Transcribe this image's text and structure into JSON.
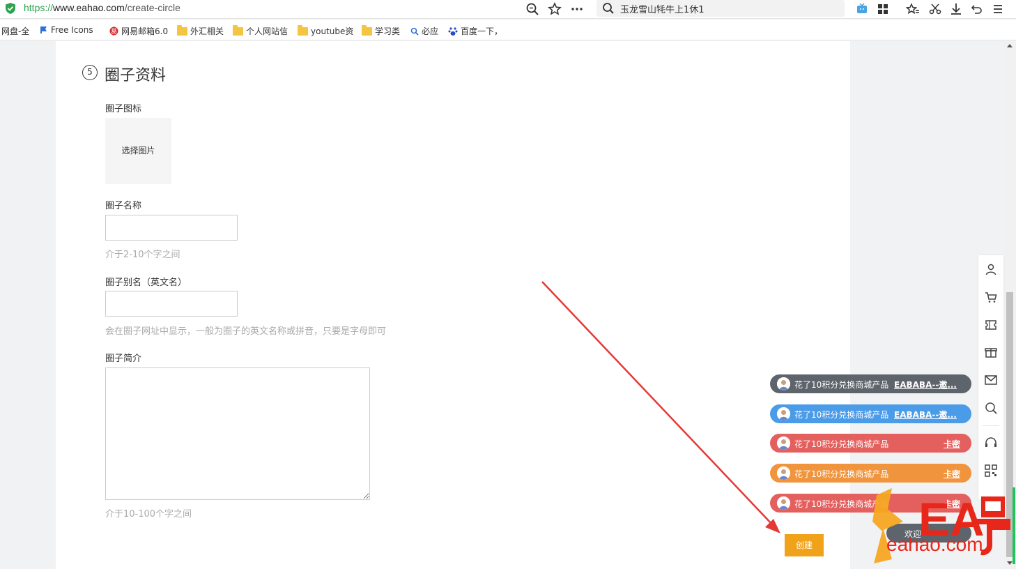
{
  "browser": {
    "url_proto": "https://",
    "url_host": "www.eahao.com",
    "url_path": "/create-circle",
    "search_query": "玉龙雪山牦牛上1休1"
  },
  "bookmarks": [
    {
      "label": "网盘-全",
      "icon": "cloud-icon"
    },
    {
      "label": "Free Icons",
      "icon": "flag-icon"
    },
    {
      "label": "网易邮箱6.0",
      "icon": "netease-icon"
    },
    {
      "label": "外汇相关",
      "icon": "folder-icon"
    },
    {
      "label": "个人网站信",
      "icon": "folder-icon"
    },
    {
      "label": "youtube资",
      "icon": "folder-icon"
    },
    {
      "label": "学习类",
      "icon": "folder-icon"
    },
    {
      "label": "必应",
      "icon": "search-icon"
    },
    {
      "label": "百度一下，",
      "icon": "baidu-icon"
    }
  ],
  "form": {
    "step_number": "5",
    "section_title": "圈子资料",
    "icon_label": "圈子图标",
    "icon_picker": "选择图片",
    "name_label": "圈子名称",
    "name_value": "",
    "name_hint": "介于2-10个字之间",
    "alias_label": "圈子别名（英文名）",
    "alias_value": "",
    "alias_hint": "会在圈子网址中显示，一般为圈子的英文名称或拼音，只要是字母即可",
    "intro_label": "圈子简介",
    "intro_value": "",
    "intro_hint": "介于10-100个字之间",
    "create_button": "创建"
  },
  "notifications": [
    {
      "message": "花了10积分兑换商城产品",
      "product": "EABABA--邀...",
      "color": "#5e646b"
    },
    {
      "message": "花了10积分兑换商城产品",
      "product": "EABABA--邀...",
      "color": "#4a9be8"
    },
    {
      "message": "花了10积分兑换商城产品",
      "product": "卡密",
      "color": "#e4605e"
    },
    {
      "message": "花了10积分兑换商城产品",
      "product": "卡密",
      "color": "#f0953e"
    },
    {
      "message": "花了10积分兑换商城产品",
      "product": "卡密",
      "color": "#e4605e"
    },
    {
      "message": "欢迎",
      "product": "",
      "color": "#5e646b"
    }
  ],
  "right_toolbar": [
    "user-icon",
    "cart-icon",
    "ticket-icon",
    "gift-icon",
    "mail-icon",
    "search-icon",
    "headset-icon",
    "qrcode-icon"
  ],
  "watermark": {
    "brand": "EA号",
    "domain": "eahao.com"
  },
  "colors": {
    "accent": "#f0a21a",
    "annotation_arrow": "#e53935"
  }
}
